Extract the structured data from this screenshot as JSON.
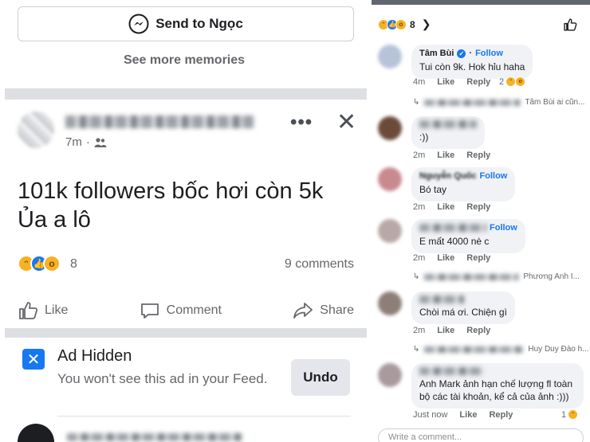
{
  "left": {
    "send_button": "Send to Ngọc",
    "see_more": "See more memories",
    "post": {
      "time": "7m",
      "text_line1": "101k followers bốc hơi còn 5k",
      "text_line2": "Ủa a lô",
      "reaction_count": "8",
      "comments_count": "9 comments",
      "actions": {
        "like": "Like",
        "comment": "Comment",
        "share": "Share"
      }
    },
    "ad": {
      "title": "Ad Hidden",
      "description": "You won't see this ad in your Feed.",
      "undo": "Undo"
    }
  },
  "right": {
    "reaction_count": "8",
    "comments": [
      {
        "name": "Tâm Bùi",
        "follow": "Follow",
        "text": "Tui còn 9k. Hok hỉu haha",
        "time": "4m",
        "like": "Like",
        "reply": "Reply",
        "reacts": "2",
        "avatar_color": "#b7c3d9"
      },
      {
        "name": "",
        "follow": "",
        "text": ":))",
        "time": "2m",
        "like": "Like",
        "reply": "Reply",
        "avatar_color": "#6b4a3a"
      },
      {
        "name": "Nguyễn Quốc",
        "follow": "Follow",
        "text": "Bó tay",
        "time": "2m",
        "like": "Like",
        "reply": "Reply",
        "avatar_color": "#c98a8f"
      },
      {
        "name": "",
        "follow": "Follow",
        "text": "E mất 4000 nè c",
        "time": "2m",
        "like": "Like",
        "reply": "Reply",
        "avatar_color": "#b9a9a6"
      },
      {
        "name": "",
        "follow": "",
        "text": "Chòi má ơi. Chiện gì",
        "time": "2m",
        "like": "Like",
        "reply": "Reply",
        "avatar_color": "#8d7f78"
      },
      {
        "name": "",
        "follow": "",
        "text": "Anh Mark ảnh hạn chế lượng fl toàn bộ các tài khoản, kể cả của ảnh :)))",
        "time": "Just now",
        "like": "Like",
        "reply": "Reply",
        "reacts": "1",
        "avatar_color": "#a99a9e"
      }
    ],
    "reply_previews": [
      "Tâm Bùi ai cũn...",
      "Phương Anh I...",
      "Huy Duy Đào h..."
    ],
    "write_placeholder": "Write a comment..."
  }
}
